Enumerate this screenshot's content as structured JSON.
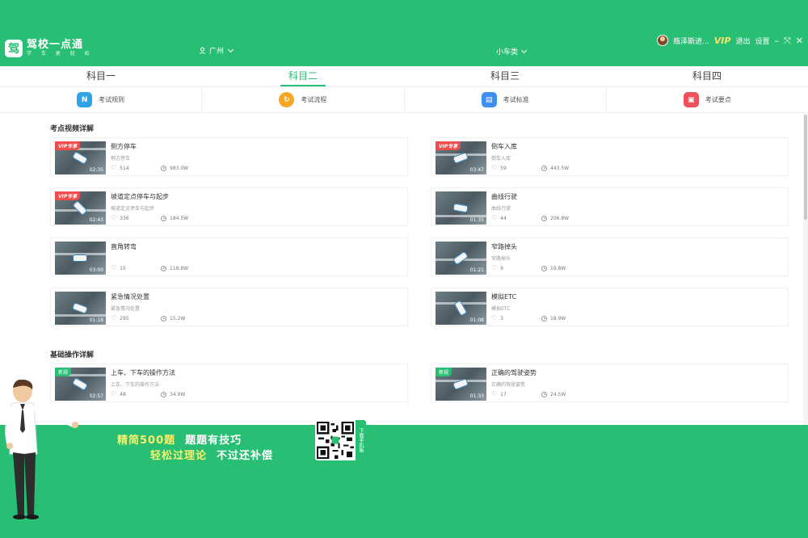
{
  "header": {
    "app_name": "驾校一点通",
    "app_slogan": "学 车 更 轻 松",
    "city": "广州",
    "car_type": "小车类",
    "username": "瓶泽斯进...",
    "vip": "VIP",
    "logout": "退出",
    "settings": "设置",
    "minimize": "–",
    "maximize": "⤧",
    "close": "✕"
  },
  "tabs": [
    {
      "label": "科目一"
    },
    {
      "label": "科目二"
    },
    {
      "label": "科目三"
    },
    {
      "label": "科目四"
    }
  ],
  "subnav": [
    {
      "label": "考试规则",
      "icon": "rules-icon",
      "color": "#2fa3e6"
    },
    {
      "label": "考试流程",
      "icon": "flow-icon",
      "color": "#f5a623"
    },
    {
      "label": "考试标准",
      "icon": "standard-icon",
      "color": "#3c8ff0"
    },
    {
      "label": "考试要点",
      "icon": "keypoint-icon",
      "color": "#f0505a"
    }
  ],
  "sections": {
    "video_title": "考点视频详解",
    "basic_title": "基础操作详解"
  },
  "videos": [
    {
      "title": "侧方停车",
      "sub": "侧方停车",
      "likes": "514",
      "views": "983.0W",
      "dur": "02:35",
      "badge": "VIP专享"
    },
    {
      "title": "倒车入库",
      "sub": "倒车入库",
      "likes": "59",
      "views": "443.5W",
      "dur": "03:47",
      "badge": "VIP专享"
    },
    {
      "title": "坡道定点停车与起步",
      "sub": "坡道定点停车与起步",
      "likes": "336",
      "views": "184.5W",
      "dur": "02:43",
      "badge": "VIP专享"
    },
    {
      "title": "曲线行驶",
      "sub": "曲线行驶",
      "likes": "44",
      "views": "206.8W",
      "dur": "01:35",
      "badge": ""
    },
    {
      "title": "直角转弯",
      "sub": "",
      "likes": "15",
      "views": "118.8W",
      "dur": "03:00",
      "badge": ""
    },
    {
      "title": "窄路掉头",
      "sub": "窄路掉头",
      "likes": "9",
      "views": "19.8W",
      "dur": "01:21",
      "badge": ""
    },
    {
      "title": "紧急情况处置",
      "sub": "紧急情况处置",
      "likes": "295",
      "views": "15.2W",
      "dur": "01:18",
      "badge": ""
    },
    {
      "title": "模拟ETC",
      "sub": "模拟ETC",
      "likes": "3",
      "views": "18.9W",
      "dur": "01:08",
      "badge": ""
    }
  ],
  "basics": [
    {
      "title": "上车、下车的操作方法",
      "sub": "上车、下车的操作方法",
      "likes": "48",
      "views": "34.9W",
      "dur": "02:57",
      "badge": "新规"
    },
    {
      "title": "正确的驾驶姿势",
      "sub": "正确的驾驶姿势",
      "likes": "17",
      "views": "24.5W",
      "dur": "01:33",
      "badge": "新规"
    }
  ],
  "banner": {
    "slogan1_a": "精简500题",
    "slogan1_b": "题题有技巧",
    "slogan2_a": "轻松过理论",
    "slogan2_b": "不过还补偿",
    "qr_label": "下载手机版"
  },
  "colors": {
    "brand": "#28bf74",
    "vip_badge": "#ee4d4d",
    "slogan": "#f7f06a"
  }
}
